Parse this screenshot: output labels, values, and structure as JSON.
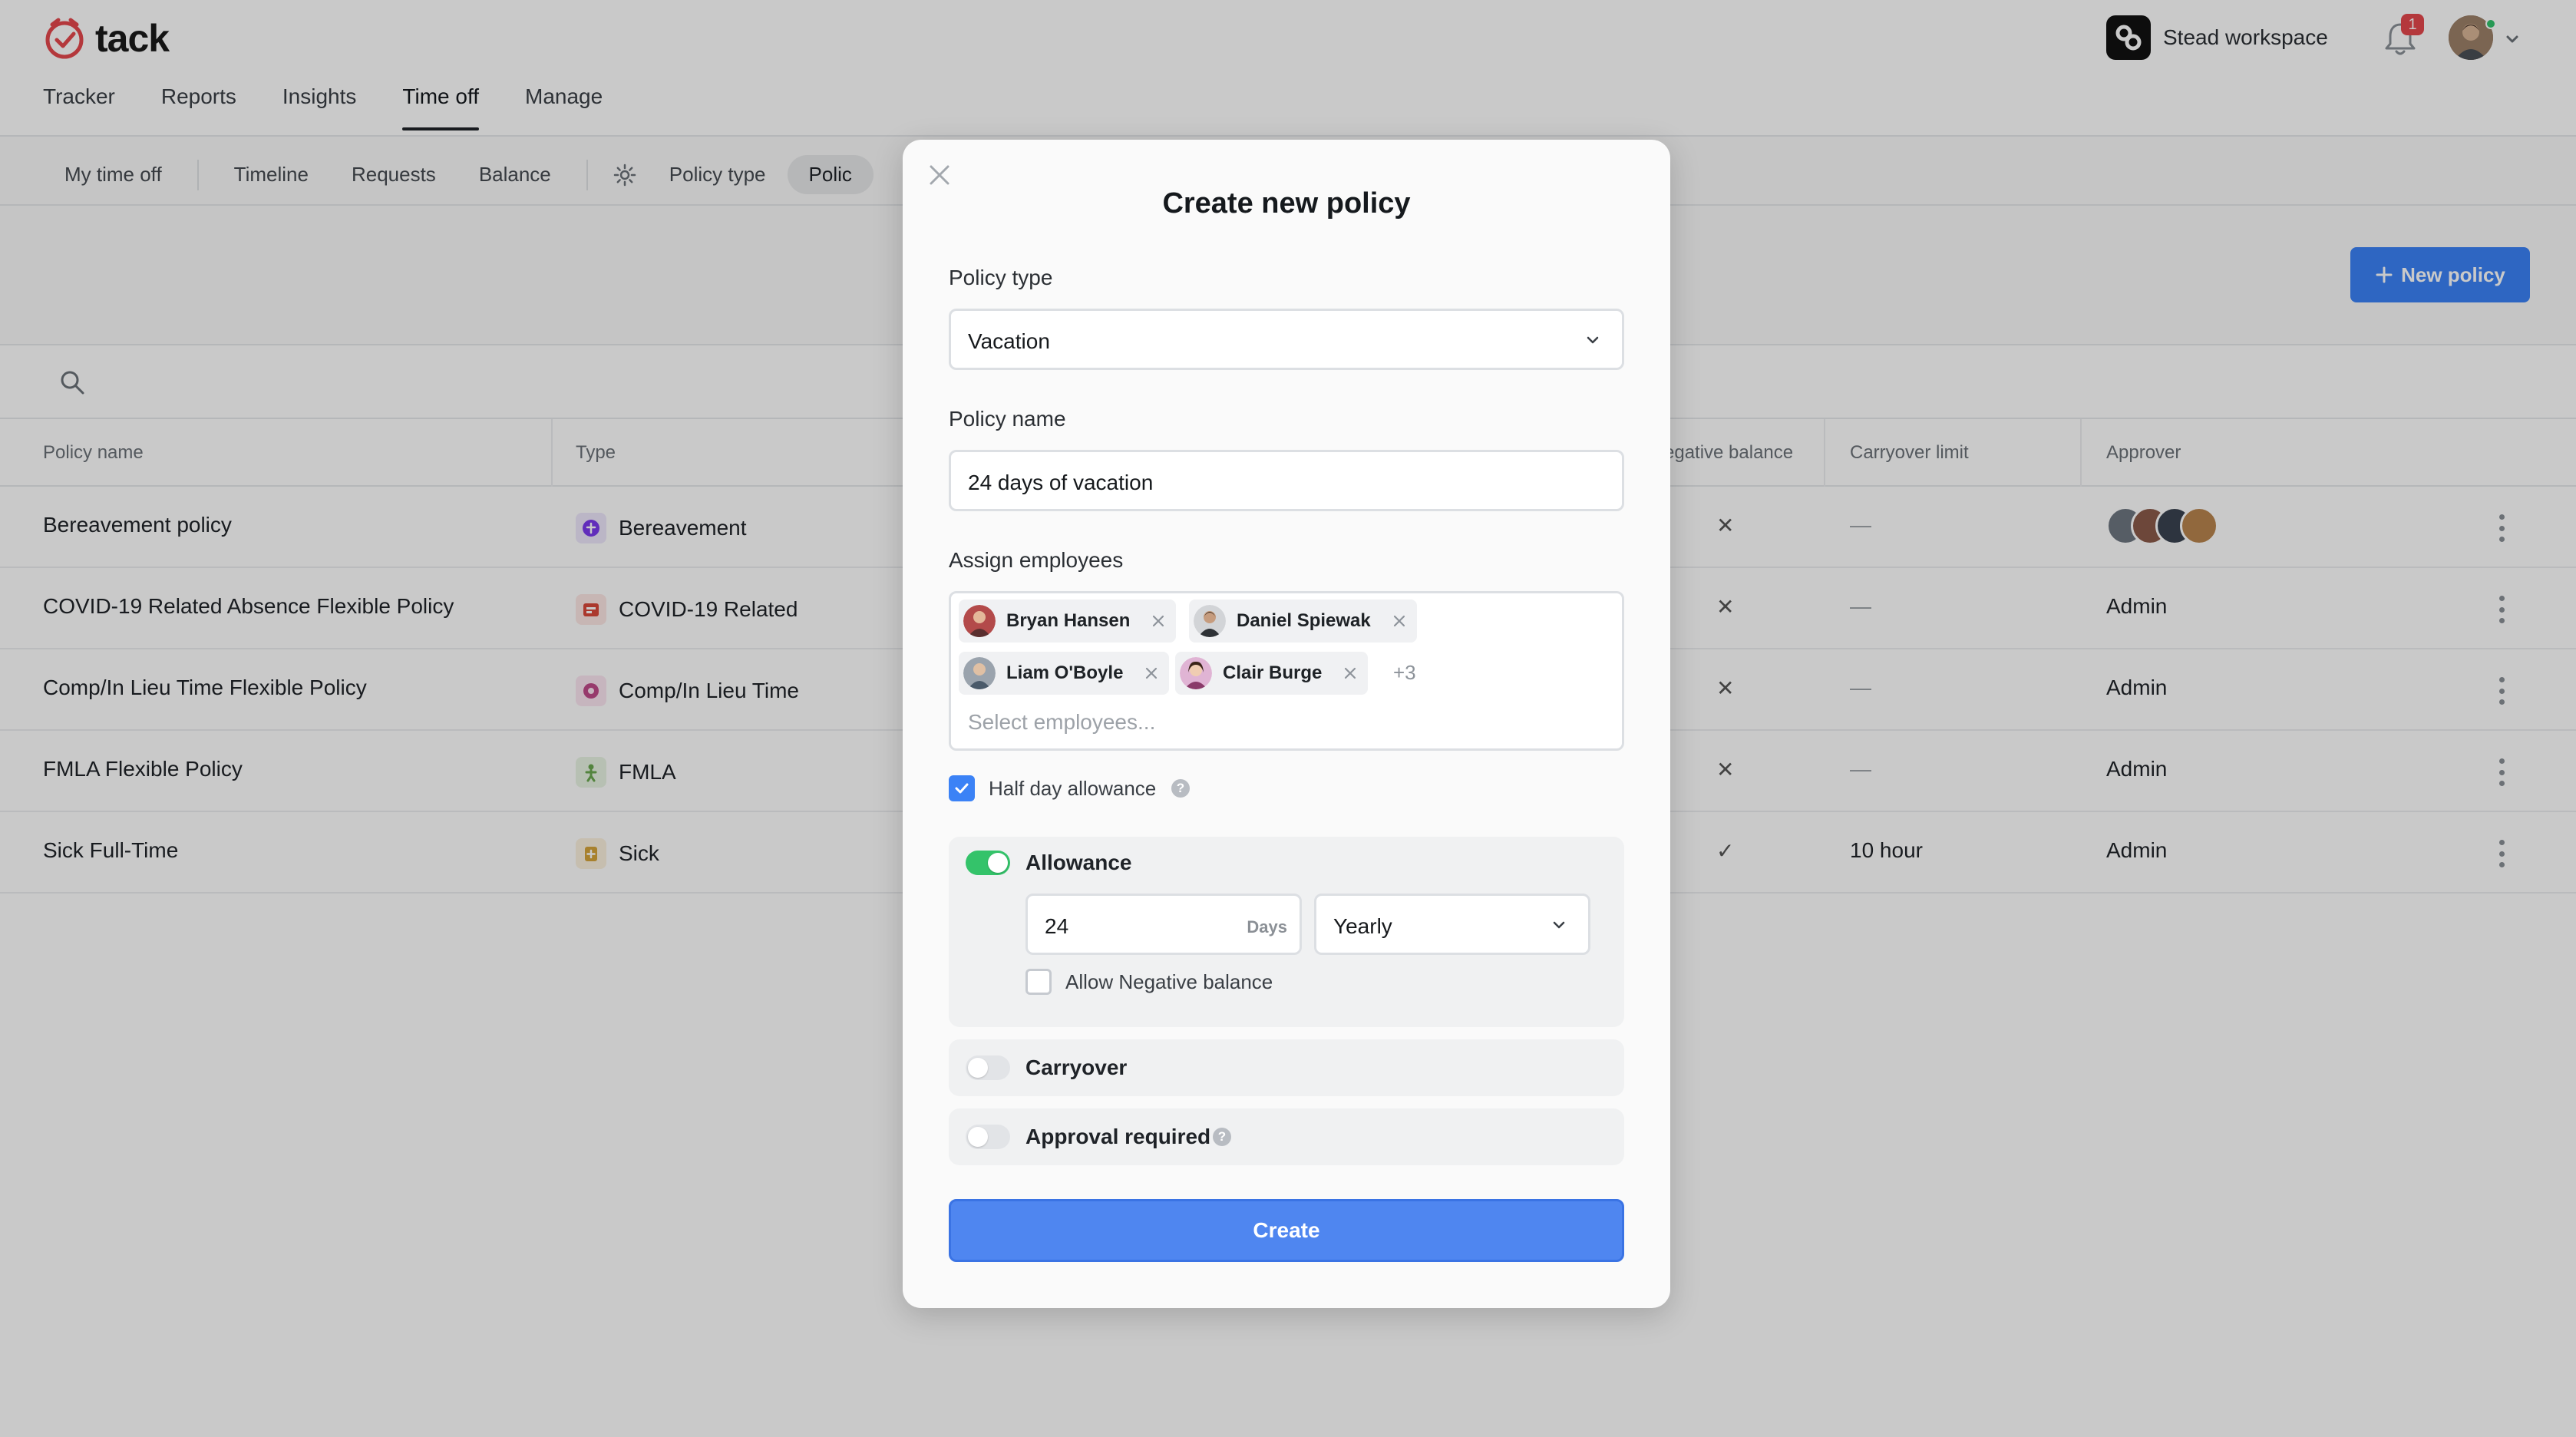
{
  "app": {
    "name": "tack"
  },
  "header": {
    "workspace": "Stead workspace",
    "notification_count": "1"
  },
  "main_nav": [
    {
      "label": "Tracker"
    },
    {
      "label": "Reports"
    },
    {
      "label": "Insights"
    },
    {
      "label": "Time off",
      "active": true
    },
    {
      "label": "Manage"
    }
  ],
  "sub_nav": {
    "my_time_off": "My time off",
    "timeline": "Timeline",
    "requests": "Requests",
    "balance": "Balance",
    "policy_type": "Policy type",
    "policies": "Polic"
  },
  "toolbar": {
    "new_policy": "New policy"
  },
  "table": {
    "columns": {
      "policy_name": "Policy name",
      "type": "Type",
      "negative_balance": "egative balance",
      "carryover_limit": "Carryover limit",
      "approver": "Approver"
    },
    "rows": [
      {
        "name": "Bereavement policy",
        "type": "Bereavement",
        "negative": "✕",
        "carryover": "—",
        "approver": ""
      },
      {
        "name": "COVID-19 Related Absence Flexible Policy",
        "type": "COVID-19 Related",
        "negative": "✕",
        "carryover": "—",
        "approver": "Admin"
      },
      {
        "name": "Comp/In Lieu Time Flexible Policy",
        "type": "Comp/In Lieu Time",
        "negative": "✕",
        "carryover": "—",
        "approver": "Admin"
      },
      {
        "name": "FMLA Flexible Policy",
        "type": "FMLA",
        "negative": "✕",
        "carryover": "—",
        "approver": "Admin"
      },
      {
        "name": "Sick Full-Time",
        "type": "Sick",
        "negative": "✓",
        "carryover": "10 hour",
        "approver": "Admin"
      }
    ],
    "type_colors": {
      "bereavement": "#7c3aed",
      "covid": "#d9473a",
      "comp": "#c04a8a",
      "fmla": "#6aa84f",
      "sick": "#d6a43a"
    }
  },
  "modal": {
    "title": "Create new policy",
    "policy_type": {
      "label": "Policy type",
      "value": "Vacation"
    },
    "policy_name": {
      "label": "Policy name",
      "value": "24 days of vacation"
    },
    "assign": {
      "label": "Assign employees",
      "chips": [
        {
          "name": "Bryan Hansen"
        },
        {
          "name": "Daniel Spiewak"
        },
        {
          "name": "Liam O'Boyle"
        },
        {
          "name": "Clair Burge"
        }
      ],
      "more": "+3",
      "placeholder": "Select employees..."
    },
    "half_day": {
      "label": "Half day allowance",
      "checked": true
    },
    "allowance": {
      "label": "Allowance",
      "enabled": true,
      "days_value": "24",
      "days_unit": "Days",
      "period": "Yearly",
      "allow_negative": {
        "label": "Allow Negative balance",
        "checked": false
      }
    },
    "carryover": {
      "label": "Carryover",
      "enabled": false
    },
    "approval": {
      "label": "Approval required",
      "enabled": false
    },
    "create_label": "Create"
  },
  "colors": {
    "primary": "#3b82f6",
    "brand_red": "#e5484d",
    "toggle_on": "#34c36a"
  }
}
